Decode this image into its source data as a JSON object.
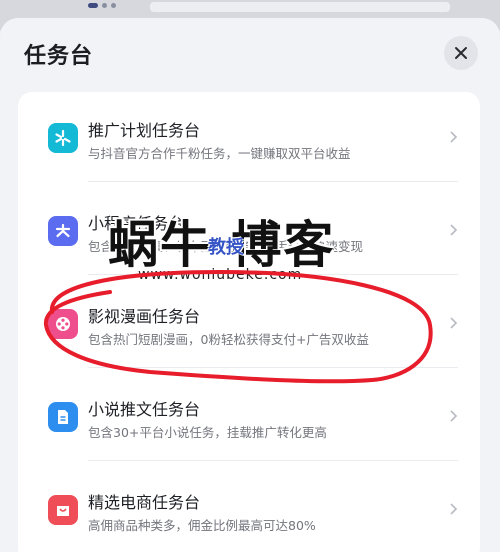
{
  "sheet": {
    "title": "任务台"
  },
  "close": {
    "icon": "close-icon"
  },
  "items": [
    {
      "title": "推广计划任务台",
      "desc": "与抖音官方合作千粉任务，一键赚取双平台收益",
      "icon": "sparkle-icon",
      "color": "#14b9d6"
    },
    {
      "title": "小程序任务台",
      "desc": "包含热门工具、发布图片任务，新手也能快速变现",
      "icon": "asterisk-icon",
      "color": "#5b6cf0"
    },
    {
      "title": "影视漫画任务台",
      "desc": "包含热门短剧漫画，0粉轻松获得支付+广告双收益",
      "icon": "film-reel-icon",
      "color": "#ee4e8c"
    },
    {
      "title": "小说推文任务台",
      "desc": "包含30+平台小说任务，挂载推广转化更高",
      "icon": "document-icon",
      "color": "#2e8ef0"
    },
    {
      "title": "精选电商任务台",
      "desc": "高佣商品种类多，佣金比例最高可达80%",
      "icon": "shopping-bag-icon",
      "color": "#ef4d57"
    }
  ],
  "watermark": {
    "big": "蜗牛 博客",
    "small": "教授",
    "url": "www.woniubeke.com"
  },
  "annotation": {
    "color": "#e81d2b"
  }
}
